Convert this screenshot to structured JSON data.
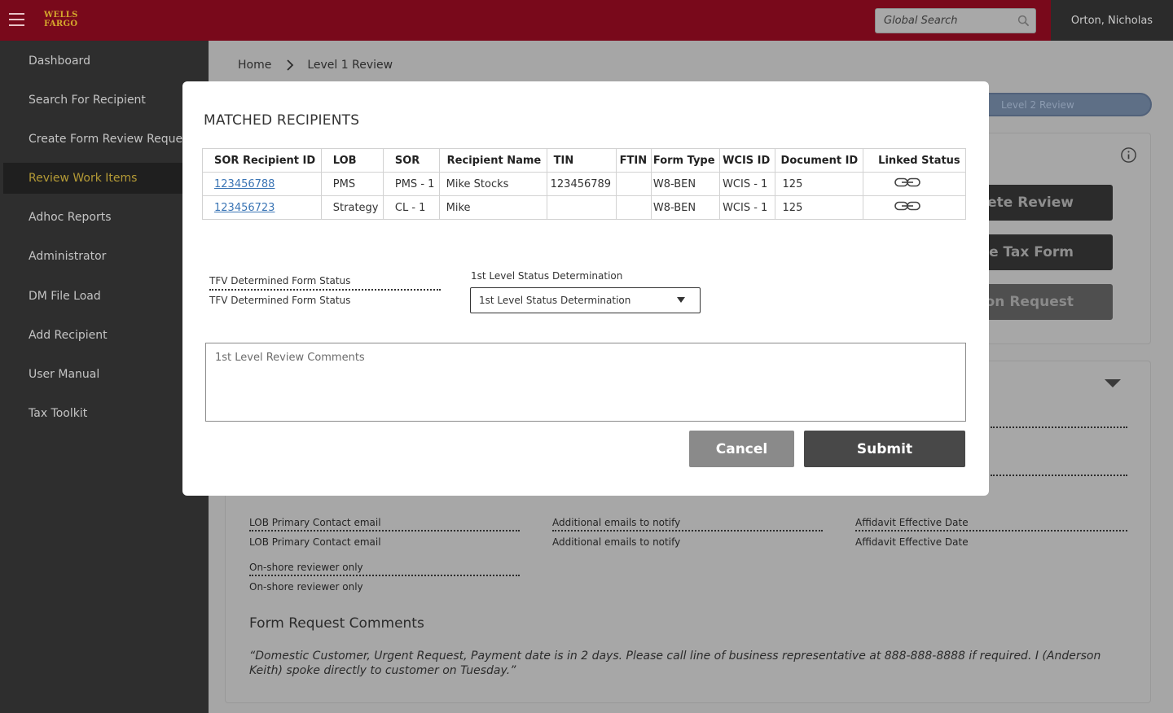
{
  "header": {
    "logo_line1": "WELLS",
    "logo_line2": "FARGO",
    "search_placeholder": "Global Search",
    "user_name": "Orton, Nicholas",
    "brand_color": "#79091b"
  },
  "sidebar": {
    "items": [
      {
        "label": "Dashboard"
      },
      {
        "label": "Search For Recipient"
      },
      {
        "label": "Create Form Review Request"
      },
      {
        "label": "Review Work Items",
        "active": true
      },
      {
        "label": "Adhoc Reports"
      },
      {
        "label": "Administrator"
      },
      {
        "label": "DM File Load"
      },
      {
        "label": "Add Recipient"
      },
      {
        "label": "User Manual"
      },
      {
        "label": "Tax Toolkit"
      }
    ]
  },
  "breadcrumb": {
    "home": "Home",
    "current": "Level 1 Review"
  },
  "background": {
    "stepper_label": "Level 2 Review",
    "action_buttons": [
      "Complete Review",
      "Create Tax Form",
      "Validation Request"
    ],
    "fields": [
      {
        "label": "LOB Primary Contact email",
        "value": "LOB Primary Contact email"
      },
      {
        "label": "Additional emails to notify",
        "value": "Additional emails to notify"
      },
      {
        "label": "Affidavit Effective Date",
        "value": "Affidavit Effective Date"
      },
      {
        "label": "On-shore reviewer only",
        "value": "On-shore reviewer only"
      }
    ],
    "comments_title": "Form Request Comments",
    "comments_text": "“Domestic Customer, Urgent Request, Payment date is in 2 days. Please call line of business representative at 888-888-8888 if required. I (Anderson Keith) spoke directly to customer on Tuesday.”"
  },
  "modal": {
    "title": "MATCHED RECIPIENTS",
    "table": {
      "headers": [
        "SOR Recipient ID",
        "LOB",
        "SOR",
        "Recipient Name",
        "TIN",
        "FTIN",
        "Form Type",
        "WCIS ID",
        "Document ID",
        "Linked Status"
      ],
      "rows": [
        {
          "id": "123456788",
          "lob": "PMS",
          "sor": "PMS - 1",
          "name": "Mike Stocks",
          "tin": "123456789",
          "ftin": "",
          "form_type": "W8-BEN",
          "wcis": "WCIS - 1",
          "doc": "125",
          "linked_icon": "link-icon"
        },
        {
          "id": "123456723",
          "lob": "Strategy",
          "sor": "CL - 1",
          "name": "Mike",
          "tin": "",
          "ftin": "",
          "form_type": "W8-BEN",
          "wcis": "WCIS - 1",
          "doc": "125",
          "linked_icon": "link-icon"
        }
      ]
    },
    "tfv_label": "TFV Determined Form Status",
    "tfv_value": "TFV Determined Form Status",
    "determination_label": "1st Level Status Determination",
    "determination_selected": "1st Level Status Determination",
    "comments_placeholder": "1st Level Review Comments",
    "cancel_label": "Cancel",
    "submit_label": "Submit"
  }
}
